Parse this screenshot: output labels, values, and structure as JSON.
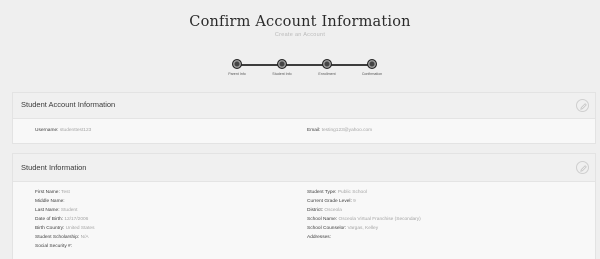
{
  "header": {
    "title": "Confirm Account Information",
    "subtitle": "Create an Account"
  },
  "stepper": {
    "steps": [
      {
        "label": "Parent Info",
        "state": "complete"
      },
      {
        "label": "Student Info",
        "state": "complete"
      },
      {
        "label": "Enrollment",
        "state": "complete"
      },
      {
        "label": "Confirmation",
        "state": "current"
      }
    ]
  },
  "student_account": {
    "title": "Student Account Information",
    "edit_icon": "pencil-icon",
    "username_label": "Username:",
    "username_value": "studenttest123",
    "email_label": "Email:",
    "email_value": "testing123@yahoo.com"
  },
  "student_info": {
    "title": "Student Information",
    "edit_icon": "pencil-icon",
    "left": [
      {
        "label": "First Name:",
        "value": "Test"
      },
      {
        "label": "Middle Name:",
        "value": ""
      },
      {
        "label": "Last Name:",
        "value": "Student"
      },
      {
        "label": "Date of Birth:",
        "value": "12/17/2006"
      },
      {
        "label": "Birth Country:",
        "value": "United States"
      },
      {
        "label": "Student Scholarship:",
        "value": "N/A"
      },
      {
        "label": "Social Security #:",
        "value": ""
      }
    ],
    "right": [
      {
        "label": "Student Type:",
        "value": "Public School"
      },
      {
        "label": "Current Grade Level:",
        "value": "9"
      },
      {
        "label": "District:",
        "value": "Osceola"
      },
      {
        "label": "School Name:",
        "value": "Osceola Virtual Franchise (Secondary)"
      },
      {
        "label": "School Counselor:",
        "value": "Vargas, Kelley"
      },
      {
        "label": "Addresses:",
        "value": ""
      }
    ]
  },
  "colors": {
    "background": "#efefef",
    "card": "#f8f8f8",
    "stepper": "#3c3c3c"
  }
}
